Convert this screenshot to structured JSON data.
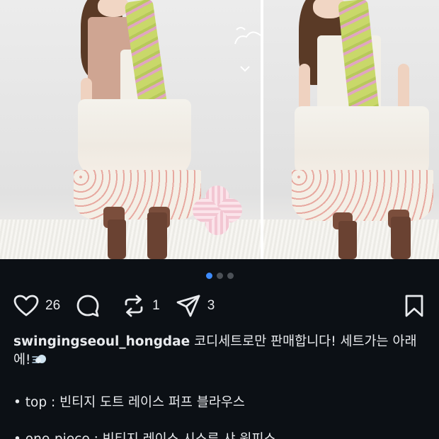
{
  "post": {
    "image_alt": "코디세트 착용 사진",
    "carousel": {
      "total": 3,
      "active_index": 0
    }
  },
  "actions": {
    "like_count": "26",
    "comment_count": "",
    "repost_count": "1",
    "share_count": "3"
  },
  "caption": {
    "username": "swingingseoul_hongdae",
    "text": " 코디세트로만 판매합니다! 세트가는 아래에!",
    "items": [
      "• top : 빈티지 도트 레이스 퍼프 블라우스",
      "• one-piece : 빈티지 레이스 시스루 샤 원피스"
    ]
  },
  "colors": {
    "background": "#0c1015",
    "text": "#e8eaed",
    "active_dot": "#3d8bfd",
    "inactive_dot": "#4c5157"
  },
  "icons": [
    "heart-icon",
    "comment-icon",
    "repost-icon",
    "share-icon",
    "bookmark-icon",
    "dash-emoji-icon"
  ]
}
